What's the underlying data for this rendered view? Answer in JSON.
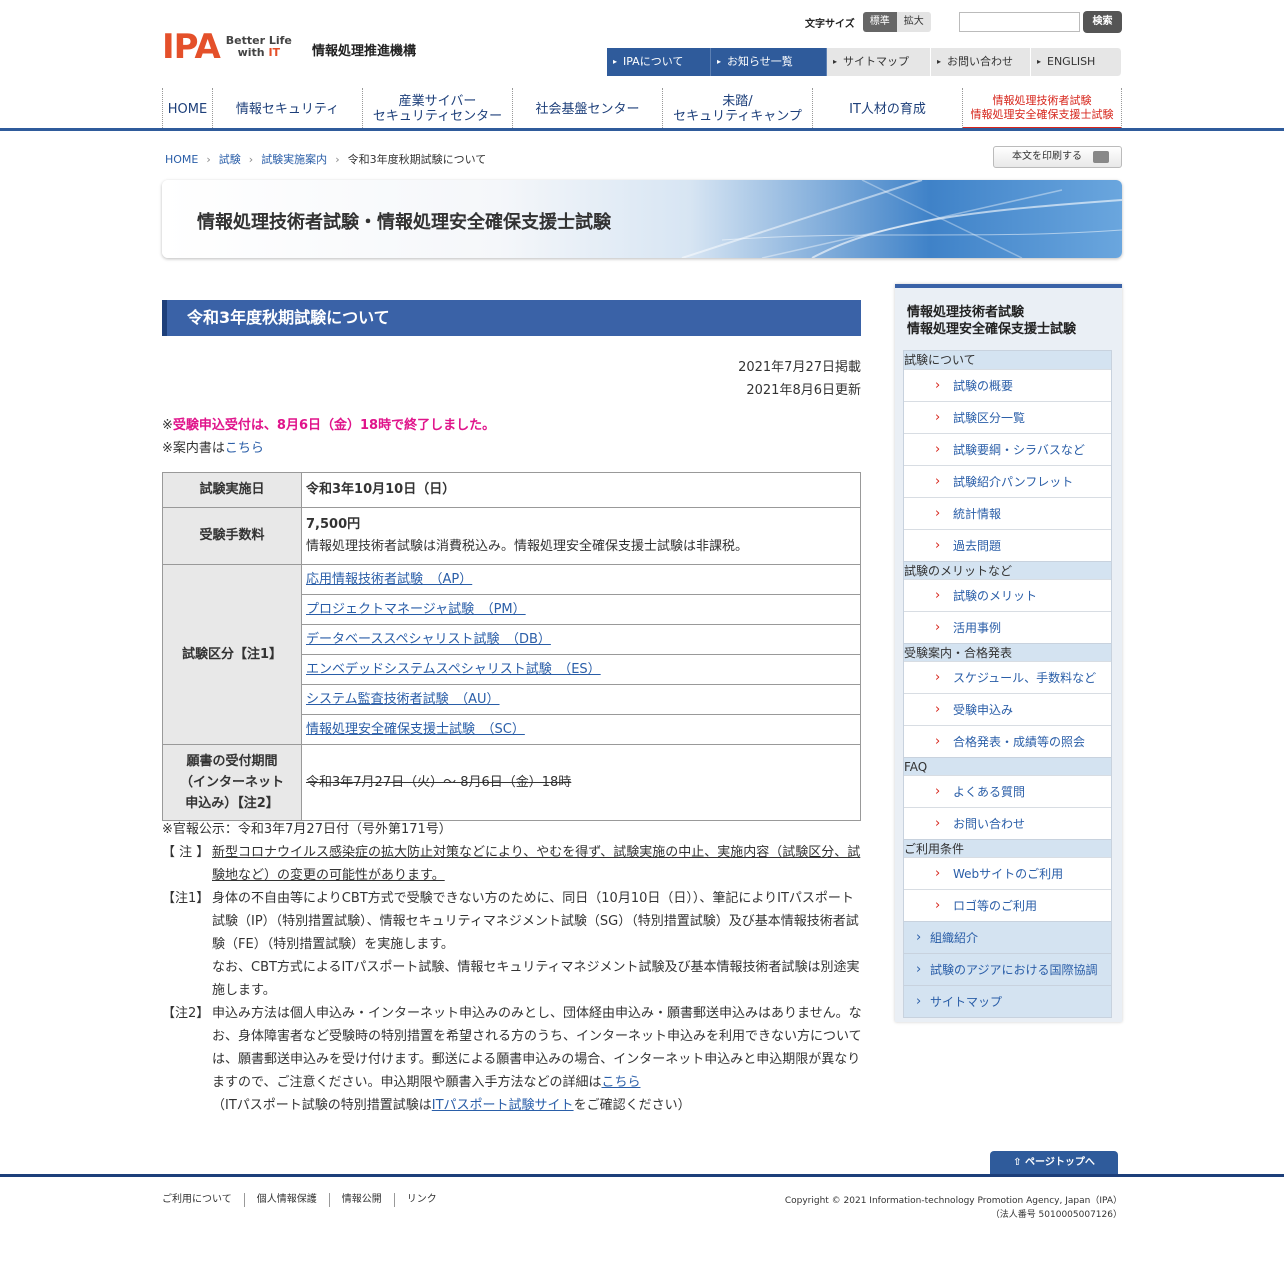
{
  "header": {
    "logo_text": "IPA",
    "logo_tag_1": "Better Life",
    "logo_tag_2a": "with ",
    "logo_tag_2b": "IT",
    "org_name": "情報処理推進機構",
    "fontsize_label": "文字サイズ",
    "fontsize_standard": "標準",
    "fontsize_large": "拡大",
    "search_placeholder": "",
    "search_button": "検索",
    "util_nav": [
      "IPAについて",
      "お知らせ一覧",
      "サイトマップ",
      "お問い合わせ",
      "ENGLISH"
    ],
    "global_nav": [
      "HOME",
      "情報セキュリティ",
      "産業サイバー\nセキュリティセンター",
      "社会基盤センター",
      "未踏/\nセキュリティキャンプ",
      "IT人材の育成",
      "情報処理技術者試験\n情報処理安全確保支援士試験"
    ]
  },
  "breadcrumb": [
    "HOME",
    "試験",
    "試験実施案内",
    "令和3年度秋期試験について"
  ],
  "print_button": "本文を印刷する",
  "banner_title": "情報処理技術者試験・情報処理安全確保支援士試験",
  "main": {
    "heading": "令和3年度秋期試験について",
    "date_posted": "2021年7月27日掲載",
    "date_updated": "2021年8月6日更新",
    "notice_prefix": "※",
    "notice_pink": "受験申込受付は、8月6日（金）18時で終了しました。",
    "guide_prefix": "※案内書は",
    "guide_link": "こちら",
    "table": {
      "date_label": "試験実施日",
      "date_value": "令和3年10月10日（日）",
      "fee_label": "受験手数料",
      "fee_value": "7,500円",
      "fee_note": "情報処理技術者試験は消費税込み。情報処理安全確保支援士試験は非課税。",
      "category_label": "試験区分【注1】",
      "categories": [
        "応用情報技術者試験　（AP）",
        "プロジェクトマネージャ試験　（PM）",
        "データベーススペシャリスト試験　（DB）",
        "エンベデッドシステムスペシャリスト試験　（ES）",
        "システム監査技術者試験　（AU）",
        "情報処理安全確保支援士試験　（SC）"
      ],
      "period_label_1": "願書の受付期間",
      "period_label_2": "（インターネット",
      "period_label_3": "申込み）【注2】",
      "period_value": "令和3年7月27日（火）～ 8月6日（金）18時"
    },
    "notes": {
      "gazette": "※官報公示：令和3年7月27日付（号外第171号）",
      "note0_label": "【 注 】",
      "note0_text": "新型コロナウイルス感染症の拡大防止対策などにより、やむを得ず、試験実施の中止、実施内容（試験区分、試験地など）の変更の可能性があります。",
      "note1_label": "【注1】",
      "note1_text": "身体の不自由等によりCBT方式で受験できない方のために、同日（10月10日（日））、筆記によりITパスポート試験（IP）（特別措置試験）、情報セキュリティマネジメント試験（SG）（特別措置試験）及び基本情報技術者試験（FE）（特別措置試験）を実施します。",
      "note1_text2": "なお、CBT方式によるITパスポート試験、情報セキュリティマネジメント試験及び基本情報技術者試験は別途実施します。",
      "note2_label": "【注2】",
      "note2_text": "申込み方法は個人申込み・インターネット申込みのみとし、団体経由申込み・願書郵送申込みはありません。なお、身体障害者など受験時の特別措置を希望される方のうち、インターネット申込みを利用できない方については、願書郵送申込みを受け付けます。郵送による願書申込みの場合、インターネット申込みと申込期限が異なりますので、ご注意ください。申込期限や願書入手方法などの詳細は",
      "note2_link": "こちら",
      "note2_tail_prefix": "（ITパスポート試験の特別措置試験は",
      "note2_tail_link": "ITパスポート試験サイト",
      "note2_tail_suffix": "をご確認ください）"
    }
  },
  "sidebar": {
    "title_1": "情報処理技術者試験",
    "title_2": "情報処理安全確保支援士試験",
    "groups": [
      {
        "category": "試験について",
        "items": [
          "試験の概要",
          "試験区分一覧",
          "試験要綱・シラバスなど",
          "試験紹介パンフレット",
          "統計情報",
          "過去問題"
        ]
      },
      {
        "category": "試験のメリットなど",
        "items": [
          "試験のメリット",
          "活用事例"
        ]
      },
      {
        "category": "受験案内・合格発表",
        "items": [
          "スケジュール、手数料など",
          "受験申込み",
          "合格発表・成績等の照会"
        ]
      },
      {
        "category": "FAQ",
        "items": [
          "よくある質問",
          "お問い合わせ"
        ]
      },
      {
        "category": "ご利用条件",
        "items": [
          "Webサイトのご利用",
          "ロゴ等のご利用"
        ]
      }
    ],
    "bottom_links": [
      "組織紹介",
      "試験のアジアにおける国際協調",
      "サイトマップ"
    ]
  },
  "footer": {
    "page_top": "ページトップへ",
    "links": [
      "ご利用について",
      "個人情報保護",
      "情報公開",
      "リンク"
    ],
    "copyright": "Copyright © 2021 Information-technology Promotion Agency, Japan（IPA）",
    "corp_number": "（法人番号 5010005007126）"
  },
  "colors": {
    "brand_blue": "#2f5b9b",
    "heading_blue": "#3a62a7",
    "logo_red": "#e4502a",
    "notice_pink": "#e0148b",
    "exam_nav_red": "#d7261c"
  }
}
